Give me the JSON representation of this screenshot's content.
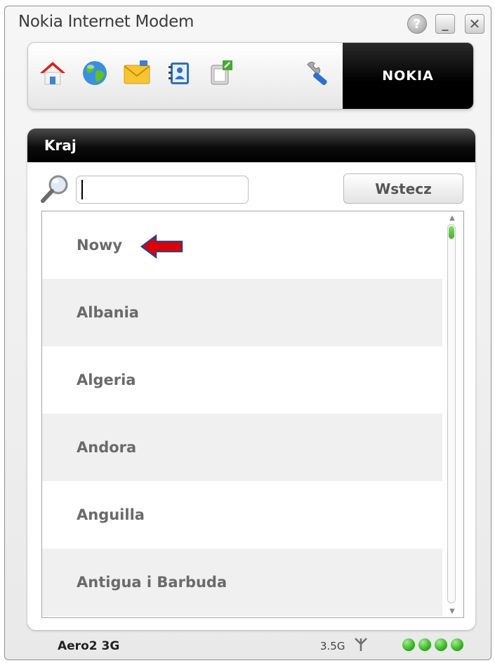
{
  "window": {
    "title": "Nokia Internet Modem",
    "help_label": "?",
    "minimize_label": "_",
    "close_label": "✕"
  },
  "toolbar": {
    "icons": [
      "home-icon",
      "internet-globe-icon",
      "messages-envelope-icon",
      "contacts-icon",
      "sms-compose-icon",
      "settings-wrench-icon"
    ],
    "brand": "NOKIA"
  },
  "panel": {
    "title": "Kraj",
    "search": {
      "value": "",
      "placeholder": ""
    },
    "back_label": "Wstecz"
  },
  "countries": [
    "Nowy",
    "Albania",
    "Algeria",
    "Andora",
    "Anguilla",
    "Antigua i Barbuda"
  ],
  "status": {
    "operator": "Aero2 3G",
    "network_type": "3.5G",
    "signal_bars": 4
  },
  "colors": {
    "accent_green": "#3fb526",
    "header_black": "#000000",
    "annotation_arrow": "#e00000"
  }
}
